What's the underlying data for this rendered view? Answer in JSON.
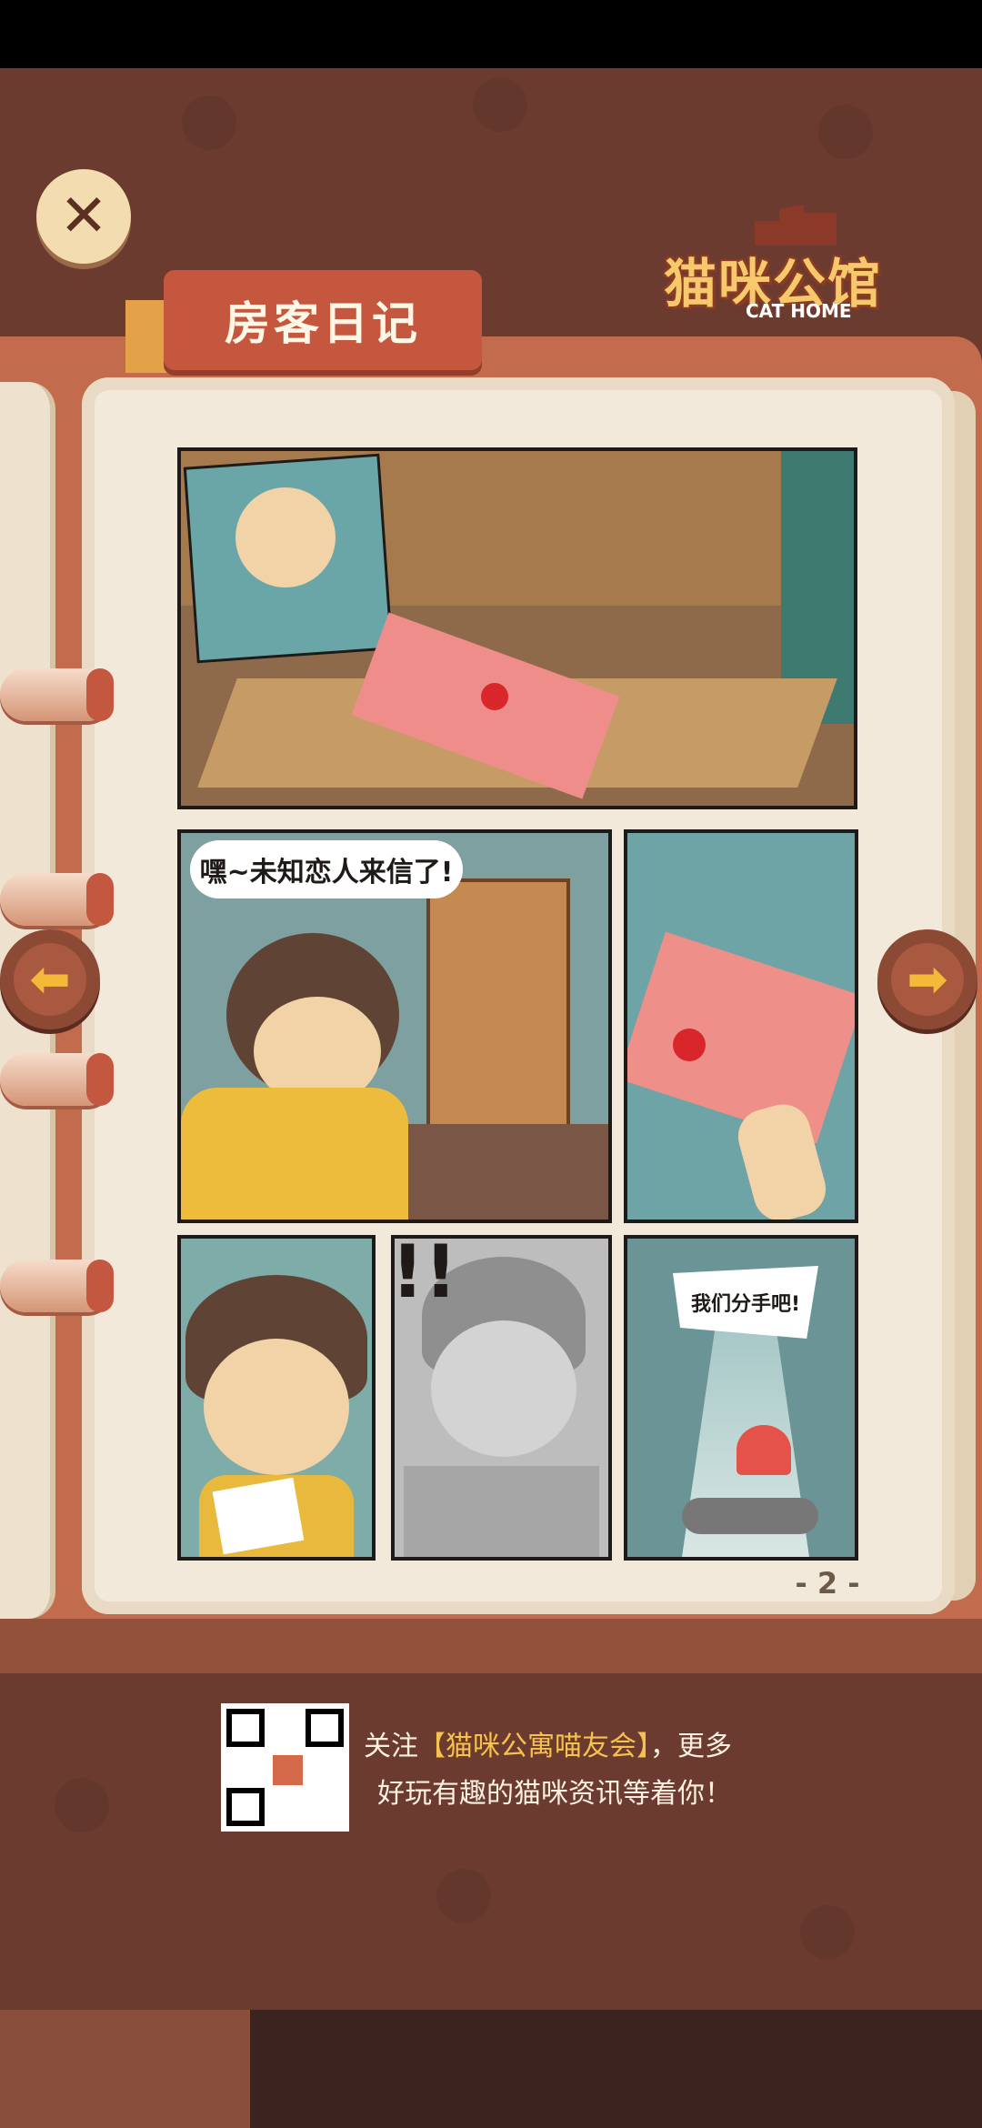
{
  "header": {
    "close_icon": "close-icon",
    "logo_main": "猫咪公馆",
    "logo_sub": "CAT HOME"
  },
  "book": {
    "tab_title": "房客日记",
    "page_number": "- 2 -",
    "prev_icon": "arrow-left-icon",
    "next_icon": "arrow-right-icon"
  },
  "comic": {
    "panel2_speech": "嘿~未知恋人来信了!",
    "panel5_exclaim": "!!",
    "panel6_speech": "我们分手吧!"
  },
  "footer": {
    "follow_prefix": "关注",
    "follow_account": "【猫咪公寓喵友会】",
    "follow_suffix": "，更多",
    "follow_line2": "好玩有趣的猫咪资讯等着你！"
  },
  "colors": {
    "background": "#6b3b2f",
    "book_cover": "#c26b4d",
    "page": "#f2e9da",
    "accent_yellow": "#f6c24d"
  }
}
